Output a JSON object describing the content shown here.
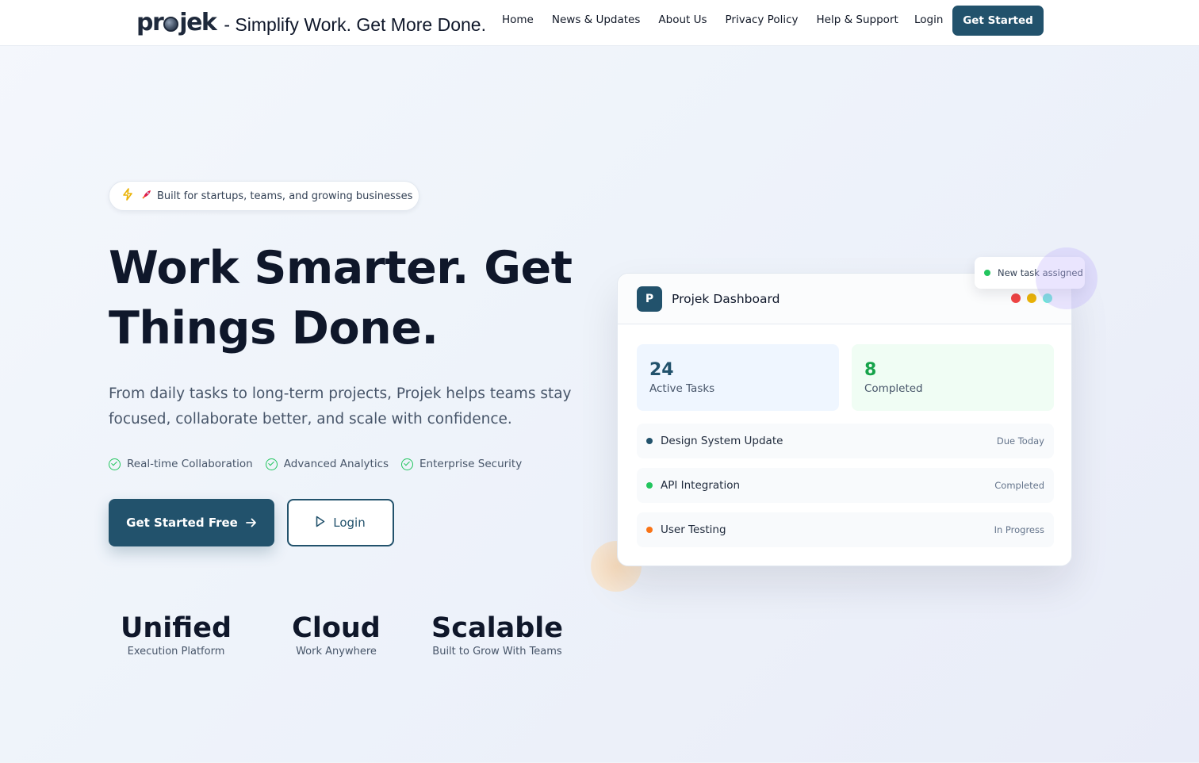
{
  "header": {
    "logo_prefix": "pr",
    "logo_suffix": "jek",
    "tagline": "- Simplify Work. Get More Done.",
    "nav": [
      "Home",
      "News & Updates",
      "About Us",
      "Privacy Policy",
      "Help & Support"
    ],
    "login": "Login",
    "cta": "Get Started"
  },
  "hero": {
    "pill_text": "Built for startups, teams, and growing businesses",
    "pill_icons": [
      "bolt-icon",
      "rocket-icon"
    ],
    "title": "Work Smarter. Get Things Done.",
    "subtitle": "From daily tasks to long-term projects, Projek helps teams stay focused, collaborate better, and scale with confidence.",
    "features": [
      "Real-time Collaboration",
      "Advanced Analytics",
      "Enterprise Security"
    ],
    "primary_button": "Get Started Free",
    "secondary_button": "Login",
    "stats": [
      {
        "big": "Unified",
        "small": "Execution Platform"
      },
      {
        "big": "Cloud",
        "small": "Work Anywhere"
      },
      {
        "big": "Scalable",
        "small": "Built to Grow With Teams"
      }
    ]
  },
  "dashboard": {
    "logo_letter": "P",
    "title": "Projek Dashboard",
    "window_dots": [
      "#ef4444",
      "#eab308",
      "#5eead4"
    ],
    "tiles": [
      {
        "num": "24",
        "label": "Active Tasks"
      },
      {
        "num": "8",
        "label": "Completed"
      }
    ],
    "tasks": [
      {
        "name": "Design System Update",
        "status": "Due Today",
        "color": "#22526c"
      },
      {
        "name": "API Integration",
        "status": "Completed",
        "color": "#22c55e"
      },
      {
        "name": "User Testing",
        "status": "In Progress",
        "color": "#f97316"
      }
    ],
    "toast": "New task assigned"
  },
  "colors": {
    "brand": "#22526c",
    "success": "#22c55e",
    "warning": "#f97316"
  }
}
